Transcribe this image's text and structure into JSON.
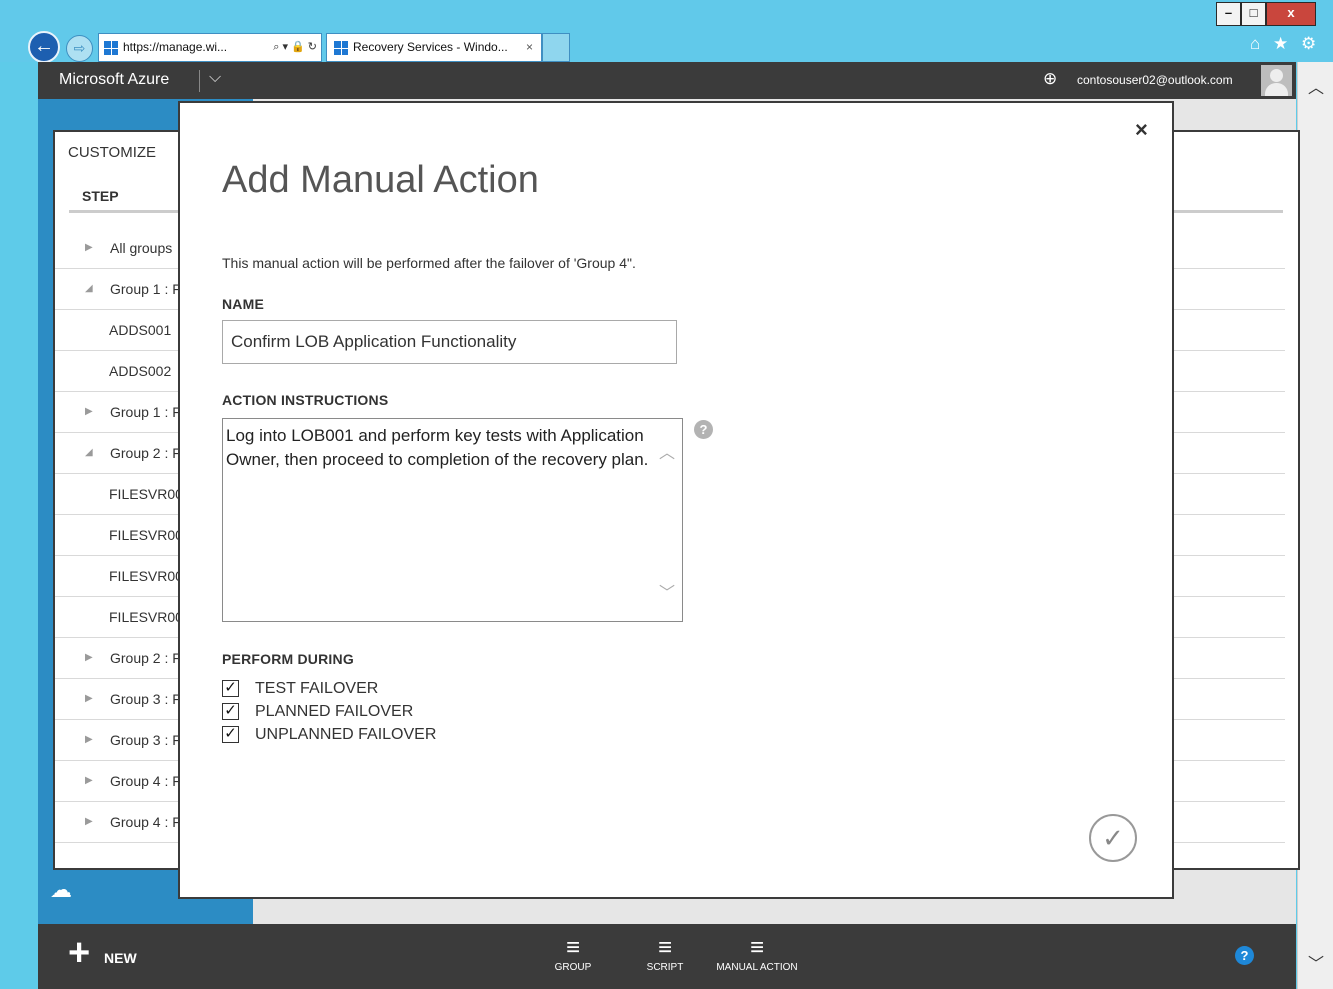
{
  "browser": {
    "window_controls": {
      "minimize": "–",
      "maximize": "□",
      "close": "x"
    },
    "back_glyph": "←",
    "forward_glyph": "⇨",
    "address": "https://manage.wi...",
    "address_tools": "⌕ ▾ 🔒 ↻",
    "tab_title": "Recovery Services - Windo...",
    "tab_close": "×",
    "toolbar_glyphs": "⌂ ★ ⚙"
  },
  "azure_header": {
    "brand": "Microsoft Azure",
    "brand_menu_glyph": "⌵",
    "globe_glyph": "⊕",
    "user_email": "contosouser02@outlook.com"
  },
  "background_panel": {
    "title": "CUSTOMIZE",
    "column_header": "STEP",
    "rows": [
      {
        "label": "All groups",
        "expander": "▶",
        "indent": false
      },
      {
        "label": "Group 1 : F",
        "expander": "◢",
        "indent": false
      },
      {
        "label": "ADDS001",
        "expander": "",
        "indent": true
      },
      {
        "label": "ADDS002",
        "expander": "",
        "indent": true
      },
      {
        "label": "Group 1 : F",
        "expander": "▶",
        "indent": false
      },
      {
        "label": "Group 2 : F",
        "expander": "◢",
        "indent": false
      },
      {
        "label": "FILESVR00",
        "expander": "",
        "indent": true
      },
      {
        "label": "FILESVR00",
        "expander": "",
        "indent": true
      },
      {
        "label": "FILESVR00",
        "expander": "",
        "indent": true
      },
      {
        "label": "FILESVR00",
        "expander": "",
        "indent": true
      },
      {
        "label": "Group 2 : F",
        "expander": "▶",
        "indent": false
      },
      {
        "label": "Group 3 : F",
        "expander": "▶",
        "indent": false
      },
      {
        "label": "Group 3 : F",
        "expander": "▶",
        "indent": false
      },
      {
        "label": "Group 4 : F",
        "expander": "▶",
        "indent": false
      },
      {
        "label": "Group 4 : F",
        "expander": "▶",
        "indent": false
      }
    ]
  },
  "modal": {
    "close_glyph": "×",
    "title": "Add Manual Action",
    "description": "This manual action will be performed after the failover of 'Group 4\".",
    "name_label": "NAME",
    "name_value": "Confirm LOB Application Functionality",
    "instructions_label": "ACTION INSTRUCTIONS",
    "instructions_value": "Log into LOB001 and perform key tests with Application Owner, then proceed to completion of the recovery plan.",
    "help_glyph": "?",
    "scroll_up_glyph": "︿",
    "scroll_down_glyph": "﹀",
    "perform_label": "PERFORM DURING",
    "options": [
      {
        "label": "TEST FAILOVER",
        "checked": true
      },
      {
        "label": "PLANNED FAILOVER",
        "checked": true
      },
      {
        "label": "UNPLANNED FAILOVER",
        "checked": true
      }
    ],
    "check_glyph": "✓",
    "confirm_glyph": "✓"
  },
  "bottom_bar": {
    "new_glyph": "+",
    "new_label": "NEW",
    "commands": [
      {
        "label": "GROUP",
        "icon": "≡"
      },
      {
        "label": "SCRIPT",
        "icon": "≡"
      },
      {
        "label": "MANUAL ACTION",
        "icon": "≡"
      }
    ],
    "help_glyph": "?"
  },
  "scrollbar": {
    "up_glyph": "︿",
    "down_glyph": "﹀"
  },
  "colors": {
    "chrome": "#61c9ea",
    "portal_header": "#3b3b3b",
    "accent_blue": "#2c8cc4",
    "modal_border": "#3b3b3b"
  }
}
